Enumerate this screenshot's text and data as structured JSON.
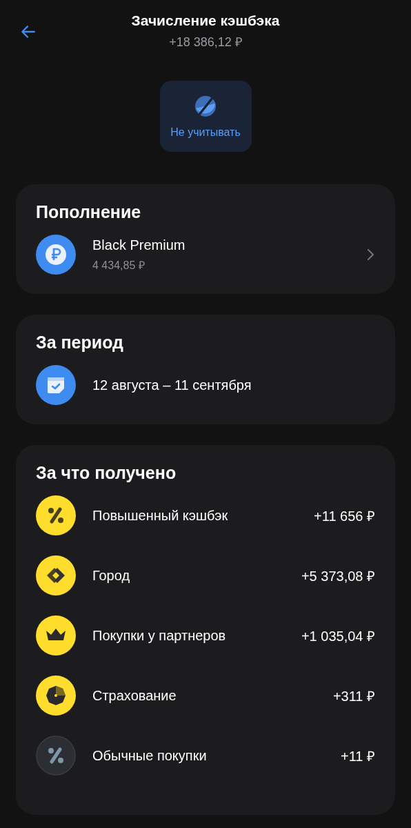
{
  "header": {
    "title": "Зачисление кэшбэка",
    "amount": "+18 386,12 ₽"
  },
  "action": {
    "label": "Не учитывать"
  },
  "top_up": {
    "title": "Пополнение",
    "account": {
      "name": "Black Premium",
      "balance": "4 434,85 ₽"
    }
  },
  "period": {
    "title": "За период",
    "range": "12 августа – 11 сентября"
  },
  "earned": {
    "title": "За что получено",
    "items": [
      {
        "kind": "percent",
        "label": "Повышенный кэшбэк",
        "amount": "+11 656 ₽"
      },
      {
        "kind": "city",
        "label": "Город",
        "amount": "+5 373,08 ₽"
      },
      {
        "kind": "crown",
        "label": "Покупки у партнеров",
        "amount": "+1 035,04 ₽"
      },
      {
        "kind": "umbrella",
        "label": "Страхование",
        "amount": "+311 ₽"
      },
      {
        "kind": "regular",
        "label": "Обычные покупки",
        "amount": "+11 ₽"
      }
    ]
  }
}
